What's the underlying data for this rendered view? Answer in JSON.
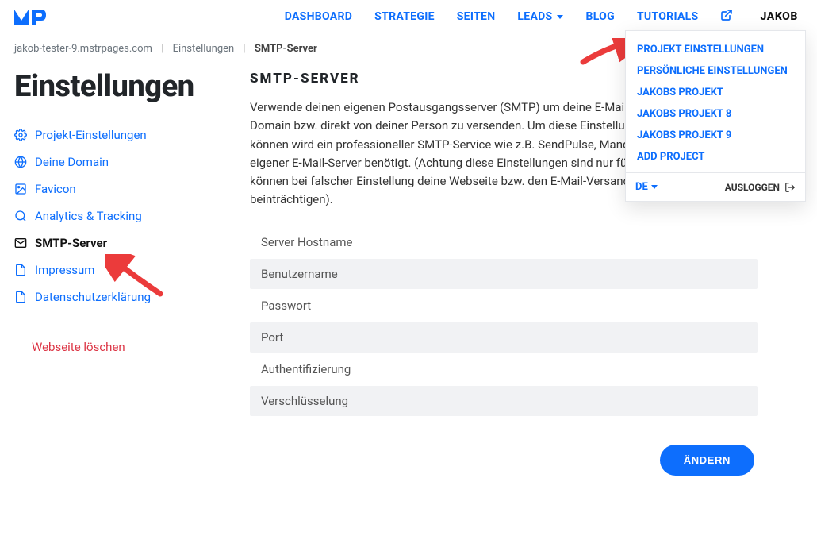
{
  "nav": {
    "items": [
      {
        "label": "DASHBOARD"
      },
      {
        "label": "STRATEGIE"
      },
      {
        "label": "SEITEN"
      },
      {
        "label": "LEADS",
        "caret": true
      },
      {
        "label": "BLOG"
      },
      {
        "label": "TUTORIALS"
      }
    ],
    "user": "JAKOB"
  },
  "dropdown": {
    "items": [
      {
        "label": "PROJEKT EINSTELLUNGEN"
      },
      {
        "label": "PERSÖNLICHE EINSTELLUNGEN"
      },
      {
        "label": "JAKOBS PROJEKT"
      },
      {
        "label": "JAKOBS PROJEKT 8"
      },
      {
        "label": "JAKOBS PROJEKT 9"
      },
      {
        "label": "ADD PROJECT"
      }
    ],
    "lang": "DE",
    "logout": "AUSLOGGEN"
  },
  "breadcrumb": {
    "domain": "jakob-tester-9.mstrpages.com",
    "section": "Einstellungen",
    "active": "SMTP-Server"
  },
  "title": "Einstellungen",
  "sidebar": {
    "items": [
      {
        "label": "Projekt-Einstellungen",
        "icon": "gear"
      },
      {
        "label": "Deine Domain",
        "icon": "globe"
      },
      {
        "label": "Favicon",
        "icon": "image"
      },
      {
        "label": "Analytics & Tracking",
        "icon": "search"
      },
      {
        "label": "SMTP-Server",
        "icon": "mail",
        "active": true
      },
      {
        "label": "Impressum",
        "icon": "doc"
      },
      {
        "label": "Datenschutzerklärung",
        "icon": "doc"
      }
    ],
    "delete": "Webseite löschen"
  },
  "main": {
    "heading": "SMTP-SERVER",
    "description": "Verwende deinen eigenen Postausgangsserver (SMTP) um deine E-Mails im Namen deiner Domain bzw. direkt von deiner Person zu versenden. Um diese Einstellungen vornehmen zu können wird ein professioneller SMTP-Service wie z.B. SendPulse, Mandrill, GSuite oder ein eigener E-Mail-Server benötigt. (Achtung diese Einstellungen sind nur für Fortgeschrittene und können bei falscher Einstellung deine Webseite bzw. den E-Mail-Versand womöglich negativ beinträchtigen).",
    "fields": [
      {
        "label": "Server Hostname",
        "soft": false
      },
      {
        "label": "Benutzername",
        "soft": true
      },
      {
        "label": "Passwort",
        "soft": false
      },
      {
        "label": "Port",
        "soft": true
      },
      {
        "label": "Authentifizierung",
        "soft": false
      },
      {
        "label": "Verschlüsselung",
        "soft": true
      }
    ],
    "button": "ÄNDERN"
  },
  "colors": {
    "blue": "#0d6efd",
    "red": "#dc3545",
    "arrow": "#eb3b3b"
  }
}
